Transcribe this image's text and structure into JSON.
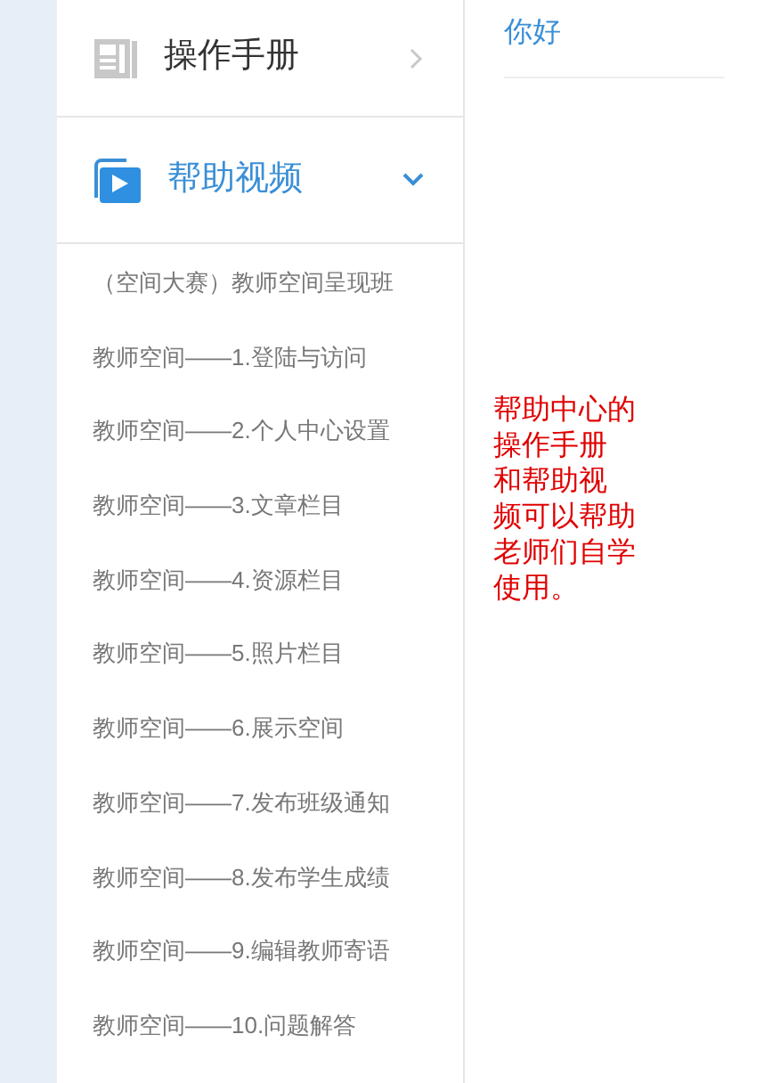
{
  "sidebar": {
    "sections": [
      {
        "label": "操作手册",
        "kind": "manual",
        "expanded": false
      },
      {
        "label": "帮助视频",
        "kind": "video",
        "expanded": true,
        "items": [
          "（空间大赛）教师空间呈现班",
          "教师空间——1.登陆与访问",
          "教师空间——2.个人中心设置",
          "教师空间——3.文章栏目",
          "教师空间——4.资源栏目",
          "教师空间——5.照片栏目",
          "教师空间——6.展示空间",
          "教师空间——7.发布班级通知",
          "教师空间——8.发布学生成绩",
          "教师空间——9.编辑教师寄语",
          "教师空间——10.问题解答"
        ]
      }
    ]
  },
  "content": {
    "title": "你好"
  },
  "annotation": {
    "lines": [
      "帮助中心的",
      "操作手册",
      "和帮助视",
      "频可以帮助",
      "老师们自学",
      "使用。"
    ]
  }
}
